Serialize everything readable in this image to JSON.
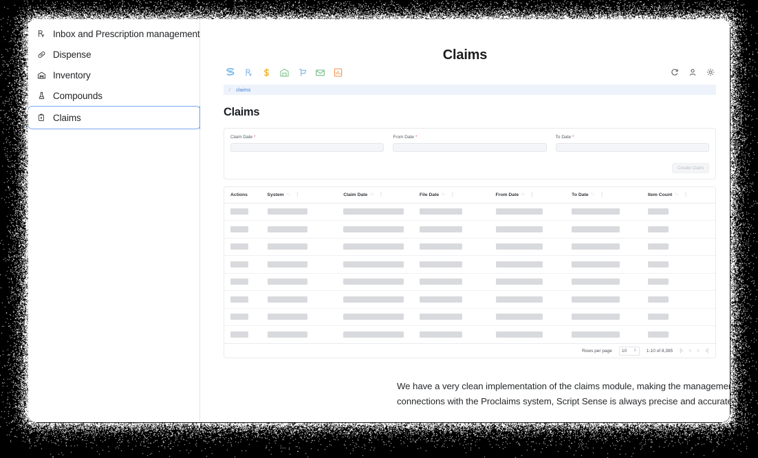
{
  "window": {
    "title": "Claims"
  },
  "sidebar": {
    "items": [
      {
        "label": "Inbox and Prescription management",
        "icon": "rx-icon",
        "selected": false
      },
      {
        "label": "Dispense",
        "icon": "pill-icon",
        "selected": false
      },
      {
        "label": "Inventory",
        "icon": "warehouse-icon",
        "selected": false
      },
      {
        "label": "Compounds",
        "icon": "flask-icon",
        "selected": false
      },
      {
        "label": "Claims",
        "icon": "clipboard-icon",
        "selected": true
      }
    ]
  },
  "app": {
    "toolbar": {
      "brand_icon": "script-sense-s-logo",
      "brand_color": "#5aa9e6",
      "icons": [
        {
          "name": "rx-icon",
          "color": "#7fb3e8"
        },
        {
          "name": "dollar-icon",
          "color": "#f0b429"
        },
        {
          "name": "warehouse-icon",
          "color": "#8fc99a"
        },
        {
          "name": "cart-icon",
          "color": "#8ab4e8"
        },
        {
          "name": "envelope-icon",
          "color": "#7fc08f"
        },
        {
          "name": "report-icon",
          "color": "#f09a5b"
        }
      ],
      "right_icons": [
        {
          "name": "refresh-icon"
        },
        {
          "name": "user-icon"
        },
        {
          "name": "settings-gear-icon"
        }
      ]
    },
    "breadcrumb": {
      "separator": "/",
      "current": "claims"
    },
    "page_title": "Claims",
    "filters": {
      "fields": [
        {
          "label": "Claim Date",
          "required": true,
          "value": "",
          "placeholder": ""
        },
        {
          "label": "From Date",
          "required": true,
          "value": "",
          "placeholder": ""
        },
        {
          "label": "To Date",
          "required": true,
          "value": "",
          "placeholder": ""
        }
      ],
      "submit_label": "Create Claim",
      "submit_disabled": true
    },
    "table": {
      "columns": [
        {
          "label": "Actions",
          "sortable": false,
          "menu": false,
          "width": "7.5%"
        },
        {
          "label": "System",
          "sortable": true,
          "menu": true,
          "width": "15.5%"
        },
        {
          "label": "Claim Date",
          "sortable": true,
          "menu": true,
          "width": "15.5%"
        },
        {
          "label": "File Date",
          "sortable": true,
          "menu": true,
          "width": "15.5%"
        },
        {
          "label": "From Date",
          "sortable": true,
          "menu": true,
          "width": "15.5%"
        },
        {
          "label": "To Date",
          "sortable": true,
          "menu": true,
          "width": "15.5%"
        },
        {
          "label": "Item Count",
          "sortable": true,
          "menu": true,
          "width": "15%"
        }
      ],
      "sort_glyph": "↑↓",
      "menu_glyph": "⋮",
      "loading": true,
      "skeleton_row_count": 8,
      "skeleton_widths": [
        "26px",
        "58px",
        "88px",
        "62px",
        "68px",
        "70px",
        "30px"
      ]
    },
    "pagination": {
      "rows_per_page_label": "Rows per page",
      "rows_per_page_value": "10",
      "range_label": "1-10 of 8,395",
      "first_glyph": "|‹",
      "prev_glyph": "‹",
      "next_glyph": "›",
      "last_glyph": "›|"
    }
  },
  "caption": {
    "text": "We have a very clean implementation of the claims module, making the management of claims a delight. With automated connections with the Proclaims system, Script Sense is always precise and accurate."
  }
}
